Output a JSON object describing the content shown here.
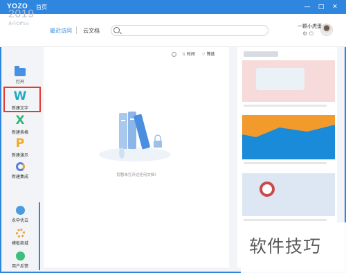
{
  "titlebar": {
    "brand": "YOZO",
    "tab": "首页",
    "minimize": "—",
    "maximize": "□",
    "close": "✕"
  },
  "header": {
    "year": "2019",
    "year_sub": "永中Office",
    "nav_recent": "最近访问",
    "nav_cloud": "云文档",
    "search_placeholder": "",
    "username": "一颗小虎蛋",
    "user_icons": "⚙ ⏻"
  },
  "sidebar": {
    "items": [
      {
        "label": "打开",
        "icon": "folder-icon",
        "color": "#4a90e2"
      },
      {
        "label": "新建文字",
        "icon": "W",
        "color": "#1fa9c4"
      },
      {
        "label": "新建表格",
        "icon": "X",
        "color": "#2bb673"
      },
      {
        "label": "新建演示",
        "icon": "P",
        "color": "#f5a623"
      },
      {
        "label": "新建集成",
        "icon": "integrate-icon",
        "color": "#5a7de0"
      }
    ],
    "bottom": [
      {
        "label": "永中优云",
        "icon": "cloud-icon",
        "color": "#4a9be0"
      },
      {
        "label": "模板商城",
        "icon": "store-icon",
        "color": "#e8a33a"
      },
      {
        "label": "用户反馈",
        "icon": "feedback-icon",
        "color": "#3cbf7a"
      }
    ]
  },
  "main": {
    "sort_time": "时间",
    "sort_filter": "筛选",
    "empty_text": "您暂未打开过任何文档!"
  },
  "watermark": "软件技巧"
}
